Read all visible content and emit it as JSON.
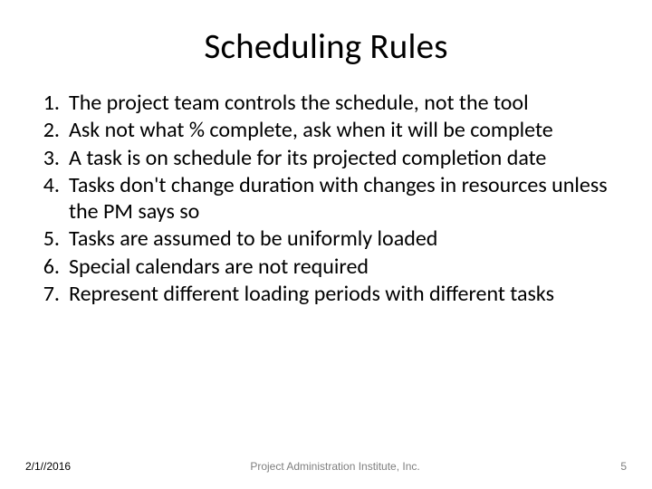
{
  "title": "Scheduling Rules",
  "items": [
    {
      "num": "1.",
      "text": "The project team controls the schedule, not the tool"
    },
    {
      "num": "2.",
      "text": "Ask not what % complete, ask when it will be complete"
    },
    {
      "num": "3.",
      "text": "A task is on schedule for its projected completion date"
    },
    {
      "num": "4.",
      "text": "Tasks don't change duration with changes in resources unless the PM says so"
    },
    {
      "num": "5.",
      "text": "Tasks are assumed to be uniformly loaded"
    },
    {
      "num": "6.",
      "text": "Special calendars are not required"
    },
    {
      "num": "7.",
      "text": "Represent different loading periods with different tasks"
    }
  ],
  "footer": {
    "date": "2/1//2016",
    "org": "Project Administration Institute, Inc.",
    "page": "5"
  }
}
